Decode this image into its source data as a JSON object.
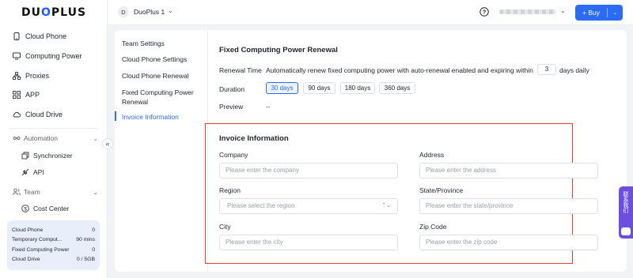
{
  "brand": {
    "logo_text_1": "DU",
    "logo_o": "O",
    "logo_text_2": "PLUS"
  },
  "sidebar": {
    "items": [
      {
        "label": "Cloud Phone",
        "icon": "phone-icon"
      },
      {
        "label": "Computing Power",
        "icon": "monitor-icon"
      },
      {
        "label": "Proxies",
        "icon": "network-icon"
      },
      {
        "label": "APP",
        "icon": "apps-grid-icon"
      },
      {
        "label": "Cloud Drive",
        "icon": "cloud-icon"
      }
    ],
    "automation": {
      "label": "Automation",
      "icon": "infinity-icon",
      "children": [
        {
          "label": "Synchronizer",
          "icon": "sync-icon"
        },
        {
          "label": "API",
          "icon": "api-icon"
        }
      ]
    },
    "team": {
      "label": "Team",
      "icon": "users-icon",
      "children": [
        {
          "label": "Cost Center",
          "icon": "dollar-icon"
        }
      ]
    },
    "usage": [
      {
        "label": "Cloud Phone",
        "value": "0"
      },
      {
        "label": "Temporary Comput...",
        "value": "90 mins"
      },
      {
        "label": "Fixed Computing Power",
        "value": "0"
      },
      {
        "label": "Cloud Drive",
        "value": "0 / 5GB"
      }
    ],
    "collapse_glyph": "«"
  },
  "header": {
    "project_initial": "D",
    "project_name": "DuoPlus 1",
    "chevron": "⌄",
    "buy_label": "+ Buy",
    "buy_drop": "⌄"
  },
  "settings_nav": {
    "items": [
      {
        "label": "Team Settings"
      },
      {
        "label": "Cloud Phone Settings"
      },
      {
        "label": "Cloud Phone Renewal"
      },
      {
        "label": "Fixed Computing Power Renewal"
      },
      {
        "label": "Invoice Information"
      }
    ],
    "active_index": 4
  },
  "renewal": {
    "title": "Fixed Computing Power Renewal",
    "renewal_time_label": "Renewal Time",
    "renewal_text": "Automatically renew fixed computing power with auto-renewal enabled and expiring within",
    "days_value": "3",
    "days_suffix": "days daily",
    "duration_label": "Duration",
    "durations": [
      "30 days",
      "90 days",
      "180 days",
      "360 days"
    ],
    "selected_duration": "30 days",
    "preview_label": "Preview",
    "preview_value": "--"
  },
  "invoice": {
    "title": "Invoice Information",
    "company": {
      "label": "Company",
      "placeholder": "Please enter the company"
    },
    "address": {
      "label": "Address",
      "placeholder": "Please enter the address"
    },
    "region": {
      "label": "Region",
      "placeholder": "Please select the region"
    },
    "state": {
      "label": "State/Province",
      "placeholder": "Please enter the state/province"
    },
    "city": {
      "label": "City",
      "placeholder": "Please enter the city"
    },
    "zip": {
      "label": "Zip Code",
      "placeholder": "Please enter the zip code"
    }
  },
  "float_widget": {
    "label": "联系我们"
  },
  "colors": {
    "accent": "#2c6bf6",
    "highlight": "#e5412f",
    "widget": "#6c4fe0"
  }
}
